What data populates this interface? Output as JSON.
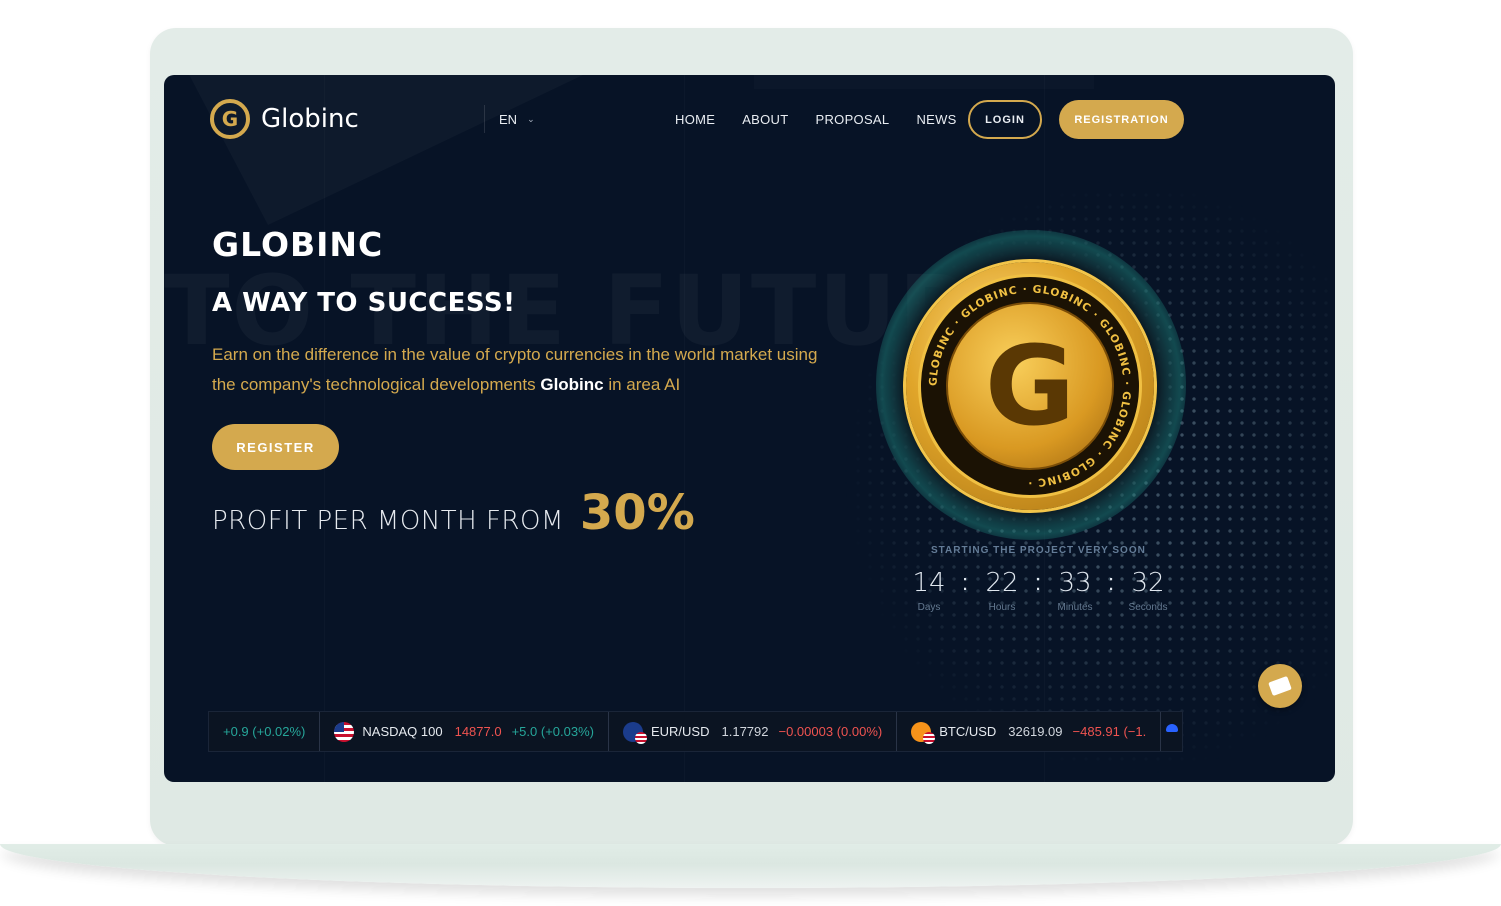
{
  "header": {
    "brand": "Globinc",
    "language": "EN",
    "nav": [
      "HOME",
      "ABOUT",
      "PROPOSAL",
      "NEWS"
    ],
    "login_label": "LOGIN",
    "registration_label": "REGISTRATION"
  },
  "hero": {
    "background_word": "TO THE FUTURE",
    "title": "GLOBINC",
    "subtitle": "A WAY TO SUCCESS!",
    "description_part1": "Earn on the difference in the value of crypto currencies in the world market using the company's technological developments ",
    "description_brand": "Globinc",
    "description_part2": " in area AI",
    "register_label": "REGISTER",
    "profit_text": "PROFIT PER MONTH FROM",
    "profit_value": "30%"
  },
  "coin": {
    "ring_text": "GLOBINC · GLOBINC · GLOBINC · GLOBINC · GLOBINC · GLOBINC ·",
    "center_letter": "G"
  },
  "countdown": {
    "label": "STARTING THE PROJECT VERY SOON",
    "units": [
      {
        "value": "14",
        "unit": "Days"
      },
      {
        "value": "22",
        "unit": "Hours"
      },
      {
        "value": "33",
        "unit": "Minutes"
      },
      {
        "value": "32",
        "unit": "Seconds"
      }
    ],
    "separator": ":"
  },
  "ticker": [
    {
      "symbol": "",
      "price": "",
      "change": "+0.9 (+0.02%)",
      "change_dir": "up",
      "flag": ""
    },
    {
      "symbol": "NASDAQ 100",
      "price": "14877.0",
      "price_dir": "down",
      "change": "+5.0 (+0.03%)",
      "change_dir": "up",
      "flag": "us-flag-icon"
    },
    {
      "symbol": "EUR/USD",
      "price": "1.17792",
      "price_dir": "neutral",
      "change": "−0.00003 (0.00%)",
      "change_dir": "down",
      "flag": "eu-us-flag-icon"
    },
    {
      "symbol": "BTC/USD",
      "price": "32619.09",
      "price_dir": "neutral",
      "change": "−485.91 (−1.",
      "change_dir": "down",
      "flag": "btc-us-flag-icon"
    }
  ],
  "colors": {
    "accent": "#d4a94e",
    "background": "#071326",
    "positive": "#26a69a",
    "negative": "#ef5350"
  }
}
